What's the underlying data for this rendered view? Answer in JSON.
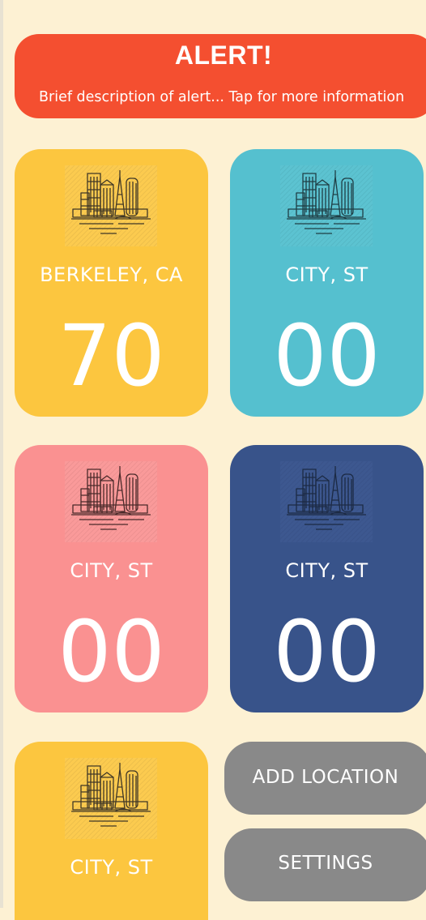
{
  "colors": {
    "background": "#fdf1d3",
    "alert": "#f44f30",
    "yellow": "#fcc63f",
    "teal": "#55c0cf",
    "pink": "#fa9191",
    "navy": "#38538a",
    "button_gray": "#898989"
  },
  "alert": {
    "title": "ALERT!",
    "description": "Brief description of alert... Tap for more information"
  },
  "cards": [
    {
      "city": "BERKELEY, CA",
      "temp": "70",
      "color": "#fcc63f",
      "icon": "city-skyline-icon"
    },
    {
      "city": "CITY, ST",
      "temp": "00",
      "color": "#55c0cf",
      "icon": "city-skyline-icon"
    },
    {
      "city": "CITY, ST",
      "temp": "00",
      "color": "#fa9191",
      "icon": "city-skyline-icon"
    },
    {
      "city": "CITY, ST",
      "temp": "00",
      "color": "#38538a",
      "icon": "city-skyline-icon"
    },
    {
      "city": "CITY, ST",
      "temp": "",
      "color": "#fcc63f",
      "icon": "city-skyline-icon"
    }
  ],
  "buttons": {
    "add_location": "ADD LOCATION",
    "settings": "SETTINGS"
  }
}
